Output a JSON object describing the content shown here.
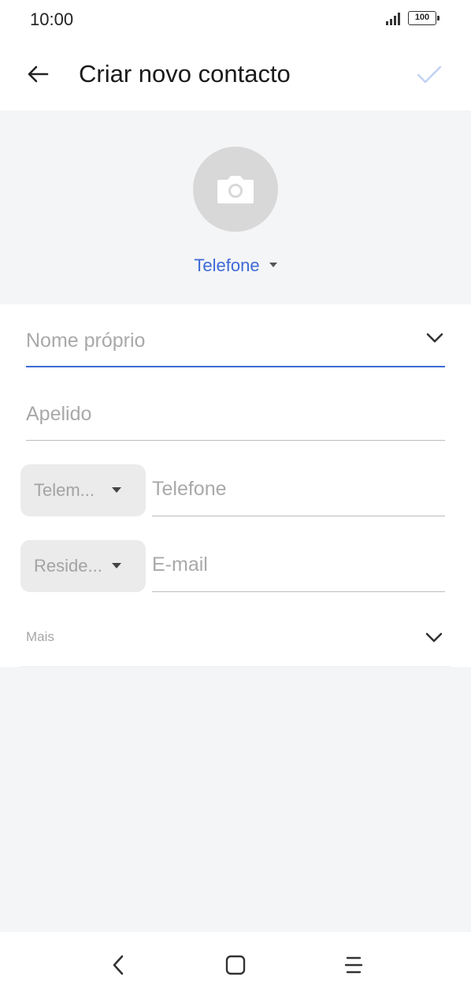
{
  "status_bar": {
    "time": "10:00",
    "battery": "100",
    "signal_icon": "signal-icon"
  },
  "app_bar": {
    "title": "Criar novo contacto",
    "back_icon": "arrow-left-icon",
    "confirm_icon": "check-icon",
    "confirm_color": "#c3d2f3"
  },
  "photo": {
    "icon": "camera-icon",
    "account_label": "Telefone"
  },
  "form": {
    "first_name": {
      "placeholder": "Nome próprio",
      "value": ""
    },
    "last_name": {
      "placeholder": "Apelido",
      "value": ""
    },
    "phone": {
      "type_label": "Telem...",
      "placeholder": "Telefone",
      "value": ""
    },
    "email": {
      "type_label": "Reside...",
      "placeholder": "E-mail",
      "value": ""
    },
    "more_label": "Mais"
  },
  "colors": {
    "accent": "#3d6ad6",
    "background": "#f4f5f7"
  },
  "nav_bar": {
    "icons": [
      "back-chevron-icon",
      "home-square-icon",
      "menu-lines-icon"
    ]
  }
}
